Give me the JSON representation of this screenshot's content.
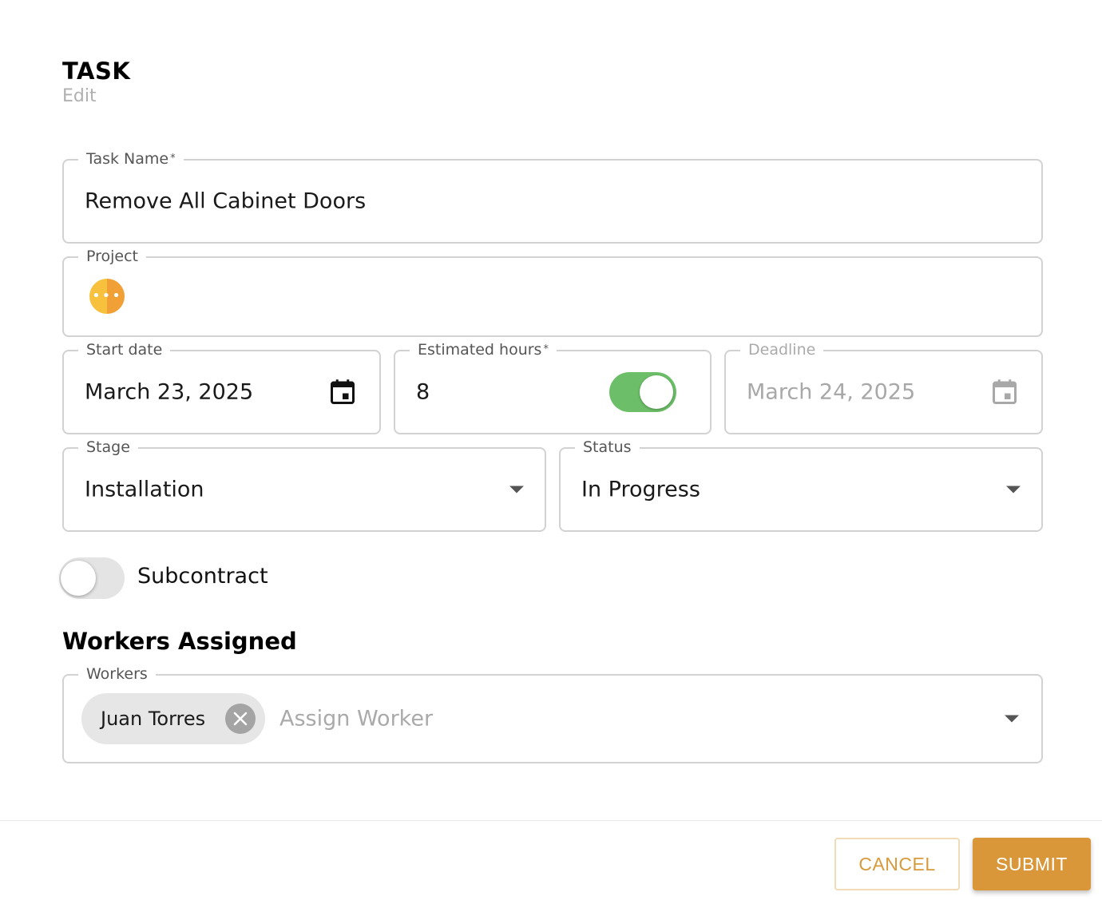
{
  "header": {
    "title": "TASK",
    "subtitle": "Edit"
  },
  "fields": {
    "task_name": {
      "label": "Task Name",
      "required_mark": "*",
      "value": "Remove All Cabinet Doors"
    },
    "project": {
      "label": "Project",
      "avatar_glyph": "•••"
    },
    "start_date": {
      "label": "Start date",
      "value": "March 23, 2025",
      "icon": "calendar-icon"
    },
    "estimated_hours": {
      "label": "Estimated hours",
      "required_mark": "*",
      "value": "8",
      "toggle_on": true
    },
    "deadline": {
      "label": "Deadline",
      "value": "March 24, 2025",
      "disabled": true,
      "icon": "calendar-icon"
    },
    "stage": {
      "label": "Stage",
      "value": "Installation"
    },
    "status": {
      "label": "Status",
      "value": "In Progress"
    }
  },
  "subcontract": {
    "label": "Subcontract",
    "on": false
  },
  "workers": {
    "section_title": "Workers Assigned",
    "label": "Workers",
    "chips": [
      {
        "name": "Juan Torres"
      }
    ],
    "placeholder": "Assign Worker"
  },
  "footer": {
    "cancel_label": "CANCEL",
    "submit_label": "SUBMIT"
  },
  "colors": {
    "accent": "#d9973a",
    "toggle_on": "#6cbf68",
    "border": "#d2d2d2",
    "project_avatar_left": "#f7c13e",
    "project_avatar_right": "#f0a035"
  }
}
